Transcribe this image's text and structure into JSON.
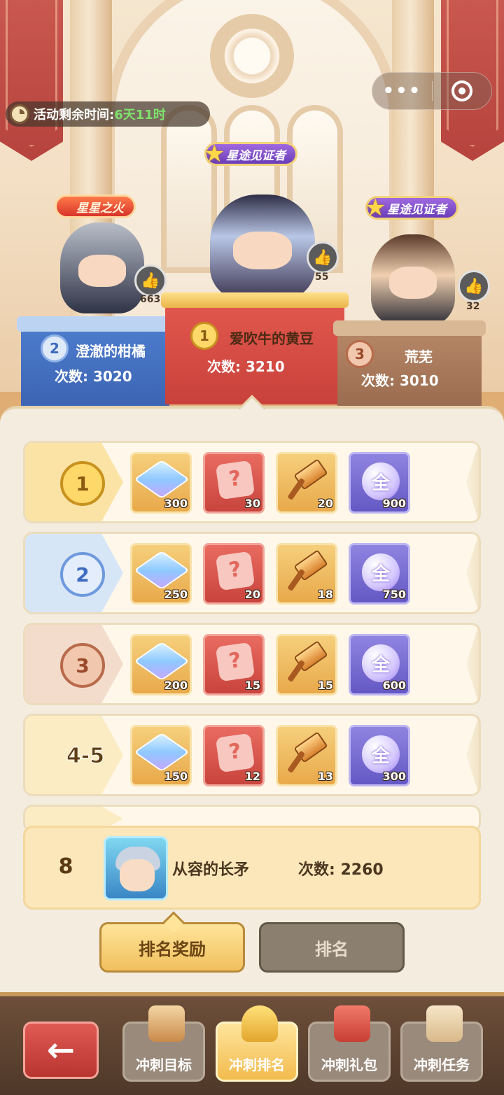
{
  "event": {
    "time_label": "活动剩余时间:",
    "time_value": "6天11时"
  },
  "capsule": {
    "more": "•••"
  },
  "podium": {
    "first": {
      "title": "星途见证者",
      "rank": "1",
      "name": "爱吹牛的黄豆",
      "count": "次数: 3210",
      "likes": "55"
    },
    "second": {
      "title": "星星之火",
      "rank": "2",
      "name": "澄澈的柑橘",
      "count": "次数: 3020",
      "likes": "663"
    },
    "third": {
      "title": "星途见证者",
      "rank": "3",
      "name": "荒芜",
      "count": "次数: 3010",
      "likes": "32"
    }
  },
  "rewards": [
    {
      "rank": "1",
      "qty": [
        "300",
        "30",
        "20",
        "900"
      ]
    },
    {
      "rank": "2",
      "qty": [
        "250",
        "20",
        "18",
        "750"
      ]
    },
    {
      "rank": "3",
      "qty": [
        "200",
        "15",
        "15",
        "600"
      ]
    },
    {
      "rank": "4-5",
      "qty": [
        "150",
        "12",
        "13",
        "300"
      ]
    }
  ],
  "reward_icons": [
    "crystal-icon",
    "puzzle-icon",
    "hammer-icon",
    "orb-icon"
  ],
  "orb_glyph": "全",
  "my_rank": {
    "rank": "8",
    "name": "从容的长矛",
    "count": "次数: 2260"
  },
  "toggles": {
    "active": "排名奖励",
    "inactive": "排名"
  },
  "nav": {
    "back": "←",
    "items": [
      "冲刺目标",
      "冲刺排名",
      "冲刺礼包",
      "冲刺任务"
    ]
  },
  "colors": {
    "gold": "#f1c05e",
    "silver_blue": "#5b8fd6",
    "bronze": "#b86a4a",
    "timer_green": "#7fe36a"
  }
}
